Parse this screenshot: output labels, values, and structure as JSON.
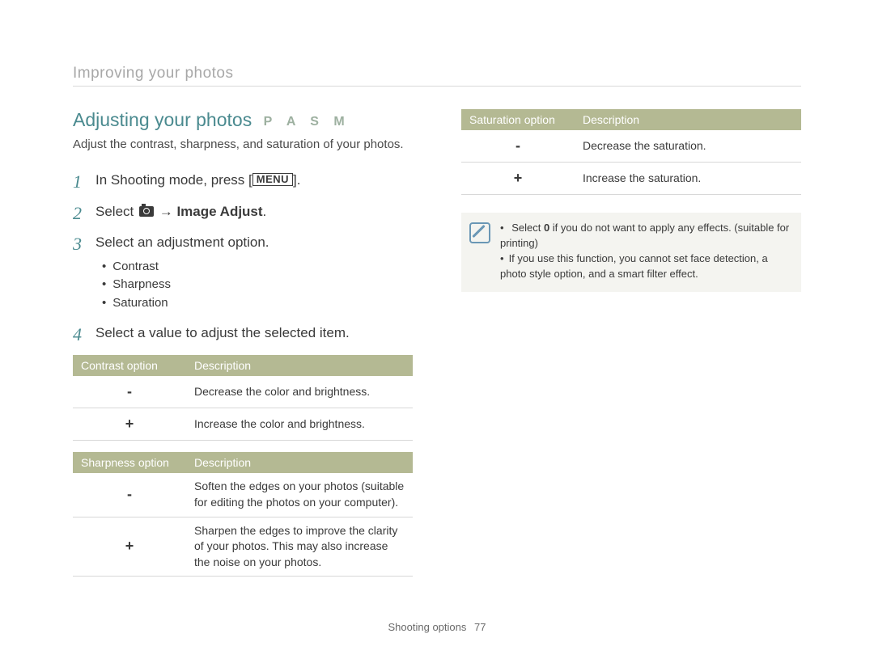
{
  "breadcrumb": "Improving your photos",
  "section_title": "Adjusting your photos",
  "modes": "P A S M",
  "intro": "Adjust the contrast, sharpness, and saturation of your photos.",
  "steps": {
    "s1_a": "In Shooting mode, press [",
    "s1_menu": "MENU",
    "s1_b": "].",
    "s2_a": "Select ",
    "s2_arrow": " → ",
    "s2_bold": "Image Adjust",
    "s2_b": ".",
    "s3": "Select an adjustment option.",
    "s3_items": [
      "Contrast",
      "Sharpness",
      "Saturation"
    ],
    "s4": "Select a value to adjust the selected item."
  },
  "tables": {
    "contrast": {
      "headers": [
        "Contrast option",
        "Description"
      ],
      "rows": [
        {
          "sym": "-",
          "desc": "Decrease the color and brightness."
        },
        {
          "sym": "+",
          "desc": "Increase the color and brightness."
        }
      ]
    },
    "sharpness": {
      "headers": [
        "Sharpness option",
        "Description"
      ],
      "rows": [
        {
          "sym": "-",
          "desc": "Soften the edges on your photos (suitable for editing the photos on your computer)."
        },
        {
          "sym": "+",
          "desc": "Sharpen the edges to improve the clarity of your photos. This may also increase the noise on your photos."
        }
      ]
    },
    "saturation": {
      "headers": [
        "Saturation option",
        "Description"
      ],
      "rows": [
        {
          "sym": "-",
          "desc": "Decrease the saturation."
        },
        {
          "sym": "+",
          "desc": "Increase the saturation."
        }
      ]
    }
  },
  "notes": {
    "n1_a": "Select ",
    "n1_bold": "0",
    "n1_b": " if you do not want to apply any effects. (suitable for printing)",
    "n2": "If you use this function, you cannot set face detection, a photo style option, and a smart filter effect."
  },
  "footer_label": "Shooting options",
  "page_number": "77"
}
